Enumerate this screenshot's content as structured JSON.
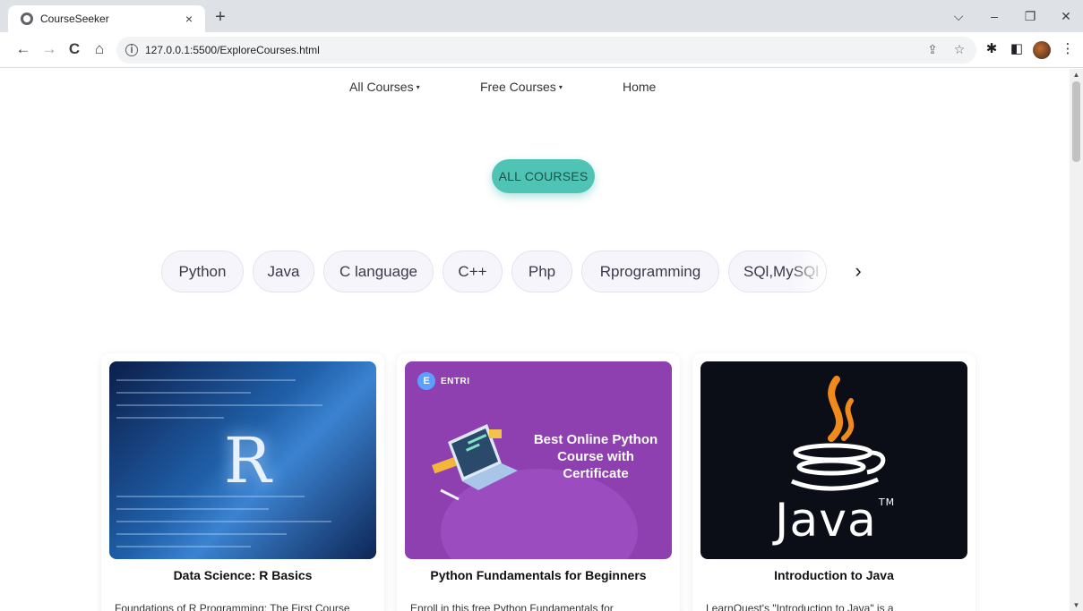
{
  "browser": {
    "tab_title": "CourseSeeker",
    "tab_close": "×",
    "new_tab": "+",
    "url": "127.0.0.1:5500/ExploreCourses.html",
    "window_controls": {
      "dropdown": "⌵",
      "minimize": "–",
      "restore": "❐",
      "close": "✕"
    },
    "nav": {
      "back": "←",
      "forward": "→",
      "reload": "C",
      "home": "⌂"
    },
    "omnibox_icons": {
      "share": "⇪",
      "bookmark": "☆"
    },
    "extension_icons": {
      "extensions": "✱",
      "side_panel": "◧",
      "menu": "⋮"
    }
  },
  "nav": {
    "items": [
      {
        "label": "All Courses",
        "caret": "▾"
      },
      {
        "label": "Free Courses",
        "caret": "▾"
      },
      {
        "label": "Home",
        "caret": ""
      }
    ]
  },
  "hero": {
    "button_label": "ALL COURSES"
  },
  "categories": {
    "chips": [
      "Python",
      "Java",
      "C language",
      "C++",
      "Php",
      "Rprogramming",
      "SQl,MySQl"
    ],
    "next": "›"
  },
  "courses": [
    {
      "title": "Data Science: R Basics",
      "description": "Foundations of R Programming: The First Course",
      "thumb_letter": "R"
    },
    {
      "title": "Python Fundamentals for Beginners",
      "description": "Enroll in this free Python Fundamentals for",
      "thumb_brand": "ENTRI",
      "thumb_brand_mark": "E",
      "thumb_heading_1": "Best Online Python",
      "thumb_heading_2": "Course with",
      "thumb_heading_3": "Certificate"
    },
    {
      "title": "Introduction to Java",
      "description": "LearnQuest's \"Introduction to Java\" is a",
      "thumb_word": "Java",
      "thumb_tm": "TM"
    }
  ],
  "colors": {
    "accent": "#4fc4b5",
    "chip_bg": "#f5f5fb",
    "python_thumb": "#8e3fb0",
    "java_thumb": "#0b0e17"
  }
}
